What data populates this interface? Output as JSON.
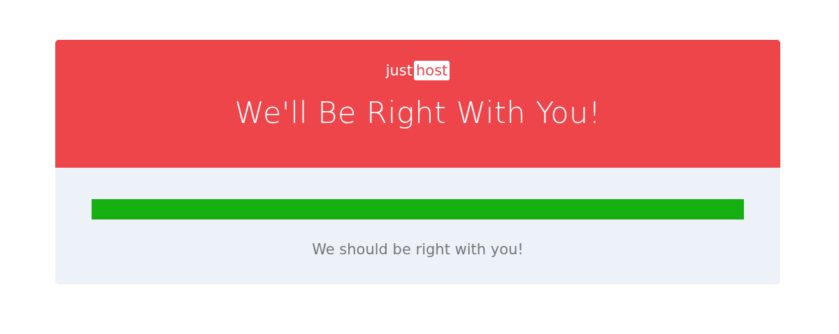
{
  "logo": {
    "part_1": "just",
    "part_2": "host"
  },
  "heading": "We'll Be Right With You!",
  "message": "We should be right with you!"
}
